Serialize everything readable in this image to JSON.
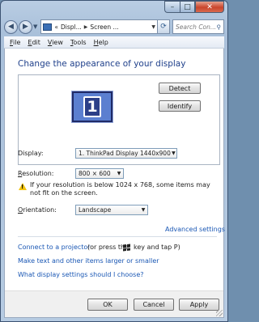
{
  "window": {
    "caption": {
      "minimize": "–",
      "maximize": "□",
      "close": "✕"
    }
  },
  "nav": {
    "back_icon": "back-arrow-icon",
    "forward_icon": "forward-arrow-icon",
    "address_overflow": "«",
    "address_segments": [
      "Displ...",
      "Screen ..."
    ],
    "refresh_icon": "refresh-icon",
    "search_placeholder": "Search Con..."
  },
  "menu": {
    "items": [
      {
        "key": "F",
        "rest": "ile"
      },
      {
        "key": "E",
        "rest": "dit"
      },
      {
        "key": "V",
        "rest": "iew"
      },
      {
        "key": "T",
        "rest": "ools"
      },
      {
        "key": "H",
        "rest": "elp"
      }
    ]
  },
  "main": {
    "title": "Change the appearance of your display",
    "monitor_number": "1",
    "detect_label": "Detect",
    "identify_label": "Identify",
    "display": {
      "label": "Display:",
      "value": "1. ThinkPad Display 1440x900"
    },
    "resolution": {
      "label_key": "R",
      "label_rest": "esolution:",
      "value": "800 × 600"
    },
    "warning": "If your resolution is below 1024 x 768, some items may not fit on the screen.",
    "orientation": {
      "label_key": "O",
      "label_rest": "rientation:",
      "value": "Landscape"
    },
    "advanced_link": "Advanced settings",
    "projector_link": "Connect to a projector",
    "projector_text_1": "(or press the",
    "projector_text_2": "key and tap P)",
    "text_size_link": "Make text and other items larger or smaller",
    "help_link": "What display settings should I choose?"
  },
  "footer": {
    "ok": "OK",
    "cancel": "Cancel",
    "apply": "Apply"
  },
  "colors": {
    "title": "#1e3f8a",
    "link": "#1a57b4",
    "monitor": "#5b7fd0"
  }
}
